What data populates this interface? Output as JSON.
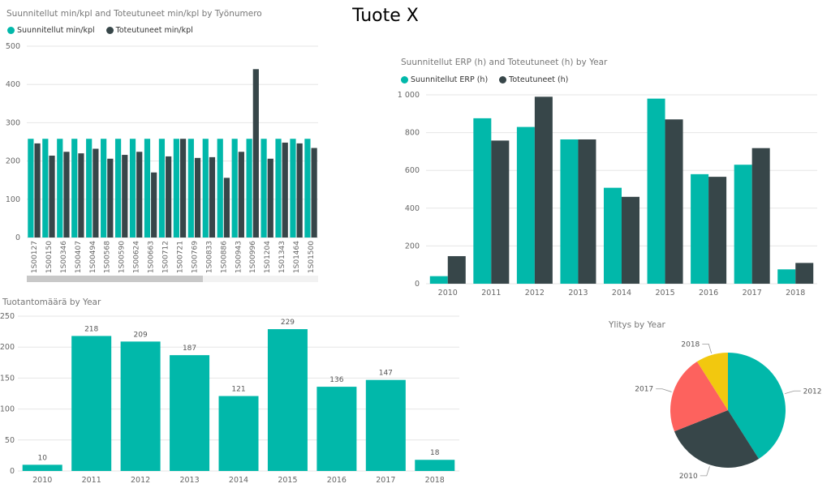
{
  "page": {
    "title": "Tuote X"
  },
  "colors": {
    "teal": "#01B8AA",
    "dark": "#374649",
    "red": "#FD625E",
    "yellow": "#F2C80F",
    "grid": "#e6e6e6",
    "axis_text": "#666666"
  },
  "chart_data": [
    {
      "id": "chart1",
      "type": "bar",
      "title": "Suunnitellut min/kpl and Toteutuneet min/kpl by Työnumero",
      "categories": [
        "1S00127",
        "1S00150",
        "1S00346",
        "1S00407",
        "1S00494",
        "1S00568",
        "1S00590",
        "1S00624",
        "1S00663",
        "1S00712",
        "1S00721",
        "1S00769",
        "1S00833",
        "1S00886",
        "1S00943",
        "1S00996",
        "1S01204",
        "1S01343",
        "1S01464",
        "1S01500"
      ],
      "series": [
        {
          "name": "Suunnitellut min/kpl",
          "color": "#01B8AA",
          "values": [
            258,
            258,
            258,
            258,
            258,
            258,
            258,
            258,
            258,
            258,
            258,
            258,
            258,
            258,
            258,
            258,
            258,
            258,
            258,
            258
          ]
        },
        {
          "name": "Toteutuneet min/kpl",
          "color": "#374649",
          "values": [
            246,
            214,
            224,
            220,
            232,
            206,
            216,
            224,
            170,
            212,
            258,
            208,
            210,
            156,
            224,
            440,
            206,
            248,
            246,
            234
          ]
        }
      ],
      "ylim": [
        0,
        500
      ],
      "yticks": [
        "0",
        "100",
        "200",
        "300",
        "400",
        "500"
      ],
      "legend": "top-left",
      "grid": true
    },
    {
      "id": "chart2",
      "type": "bar",
      "title": "Suunnitellut  ERP  (h) and Toteutuneet (h) by Year",
      "categories": [
        "2010",
        "2011",
        "2012",
        "2013",
        "2014",
        "2015",
        "2016",
        "2017",
        "2018"
      ],
      "series": [
        {
          "name": "Suunnitellut  ERP  (h)",
          "color": "#01B8AA",
          "values": [
            40,
            876,
            830,
            764,
            508,
            980,
            580,
            630,
            76
          ]
        },
        {
          "name": "Toteutuneet (h)",
          "color": "#374649",
          "values": [
            146,
            758,
            990,
            764,
            460,
            870,
            566,
            718,
            110
          ]
        }
      ],
      "ylim": [
        0,
        1000
      ],
      "yticks": [
        "0",
        "200",
        "400",
        "600",
        "800",
        "1 000"
      ],
      "legend": "top-left",
      "grid": true
    },
    {
      "id": "chart3",
      "type": "bar",
      "title": "Tuotantomäärä by Year",
      "categories": [
        "2010",
        "2011",
        "2012",
        "2013",
        "2014",
        "2015",
        "2016",
        "2017",
        "2018"
      ],
      "values": [
        10,
        218,
        209,
        187,
        121,
        229,
        136,
        147,
        18
      ],
      "labels": [
        "10",
        "218",
        "209",
        "187",
        "121",
        "229",
        "136",
        "147",
        "18"
      ],
      "color": "#01B8AA",
      "ylim": [
        0,
        250
      ],
      "yticks": [
        "0",
        "50",
        "100",
        "150",
        "200",
        "250"
      ],
      "grid": true
    },
    {
      "id": "chart4",
      "type": "pie",
      "title": "Ylitys by Year",
      "slices": [
        {
          "label": "2012",
          "value": 41,
          "color": "#01B8AA"
        },
        {
          "label": "2010",
          "value": 28,
          "color": "#374649"
        },
        {
          "label": "2017",
          "value": 22,
          "color": "#FD625E"
        },
        {
          "label": "2018",
          "value": 9,
          "color": "#F2C80F"
        }
      ]
    }
  ]
}
